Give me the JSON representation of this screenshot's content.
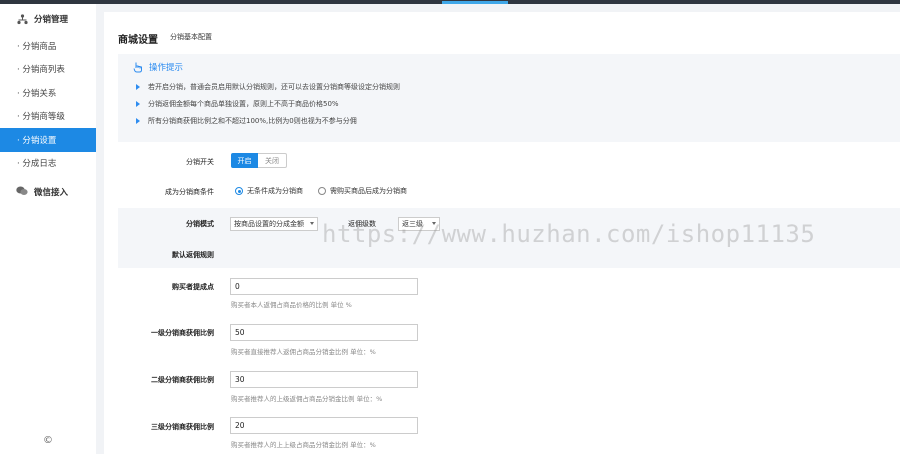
{
  "sidebar": {
    "section_title": "分销管理",
    "items": [
      {
        "label": "· 分销商品"
      },
      {
        "label": "· 分销商列表"
      },
      {
        "label": "· 分销关系"
      },
      {
        "label": "· 分销商等级"
      },
      {
        "label": "· 分销设置"
      },
      {
        "label": "· 分成日志"
      }
    ],
    "section2_title": "微信接入",
    "footer": "©"
  },
  "page": {
    "title": "商城设置",
    "subtitle": "分销基本配置"
  },
  "tips": {
    "title": "操作提示",
    "items": [
      "若开启分销，普通会员启用默认分销规则，还可以去设置分销商等级设定分销规则",
      "分销返佣金额每个商品单独设置，原则上不高于商品价格50%",
      "所有分销商获佣比例之和不超过100%,比例为0则也视为不参与分佣"
    ]
  },
  "form": {
    "switch_label": "分销开关",
    "switch_on": "开启",
    "switch_off": "关闭",
    "condition_label": "成为分销商条件",
    "condition_options": [
      "无条件成为分销商",
      "需购买商品后成为分销商"
    ],
    "mode_label": "分销模式",
    "mode_value": "按商品设置的分成金额",
    "levels_label": "返佣级数",
    "levels_value": "返三级",
    "default_rule_label": "默认返佣规则",
    "buyer_label": "购买者提成点",
    "buyer_value": "0",
    "buyer_help": "购买者本人返佣占商品价格的比例 单位 %",
    "level1_label": "一级分销商获佣比例",
    "level1_value": "50",
    "level1_help": "购买者直接推荐人返佣占商品分销金比例 单位：%",
    "level2_label": "二级分销商获佣比例",
    "level2_value": "30",
    "level2_help": "购买者推荐人的上级返佣占商品分销金比例 单位：%",
    "level3_label": "三级分销商获佣比例",
    "level3_value": "20",
    "level3_help": "购买者推荐人的上上级占商品分销金比例 单位：%"
  },
  "watermark": "https://www.huzhan.com/ishop11135",
  "colors": {
    "accent": "#1d89e4",
    "tips_blue": "#2d8cf0",
    "topbar": "#2f3640"
  }
}
